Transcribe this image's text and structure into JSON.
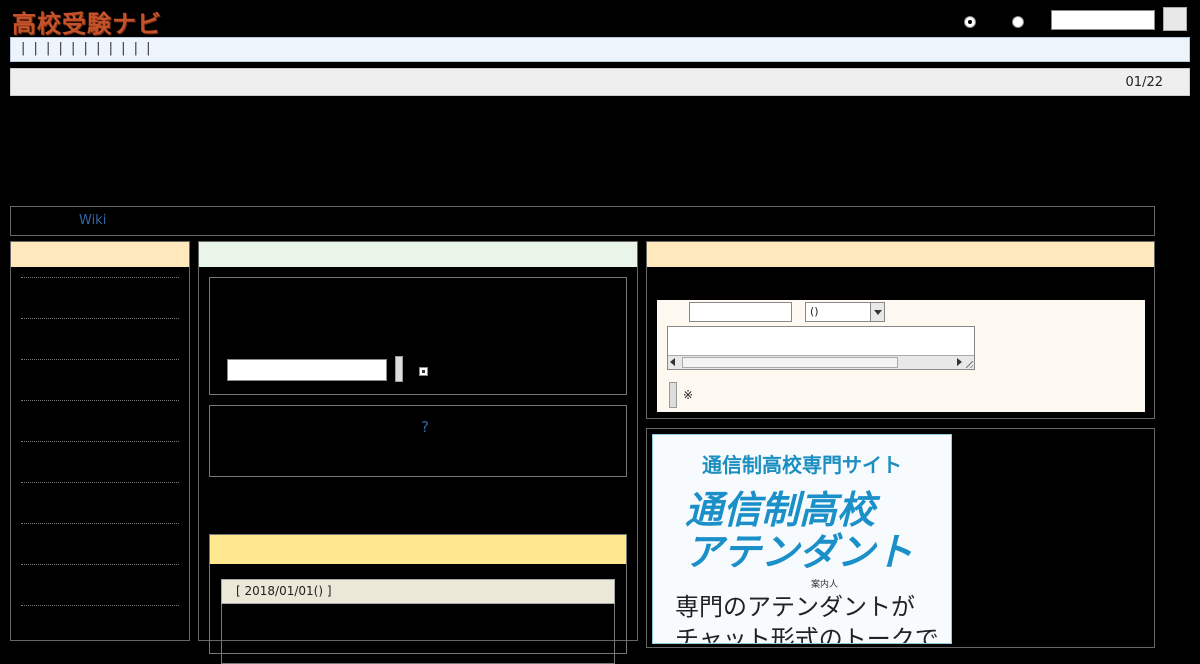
{
  "header": {
    "logo_text": "高校受験ナビ",
    "search_placeholder": "",
    "search_button_label": ""
  },
  "nav": {
    "text": "| | | | | | | | | | |"
  },
  "date_bar": {
    "date": "01/22"
  },
  "wiki_bar": {
    "link": "Wiki"
  },
  "center": {
    "help_link": "?",
    "post_header": "[ 2018/01/01() ]"
  },
  "right": {
    "select_value": "()",
    "note": "※"
  },
  "ad": {
    "subtitle": "通信制高校専門サイト",
    "title_line1": "通信制高校",
    "title_line2": "アテンダント",
    "ruby": "案内人",
    "body_line1": "専門のアテンダントが",
    "body_line2": "チャット形式のトークで"
  },
  "colors": {
    "logo": "#c4522a",
    "link": "#3566a3",
    "ad_accent": "#1a8fc8"
  }
}
